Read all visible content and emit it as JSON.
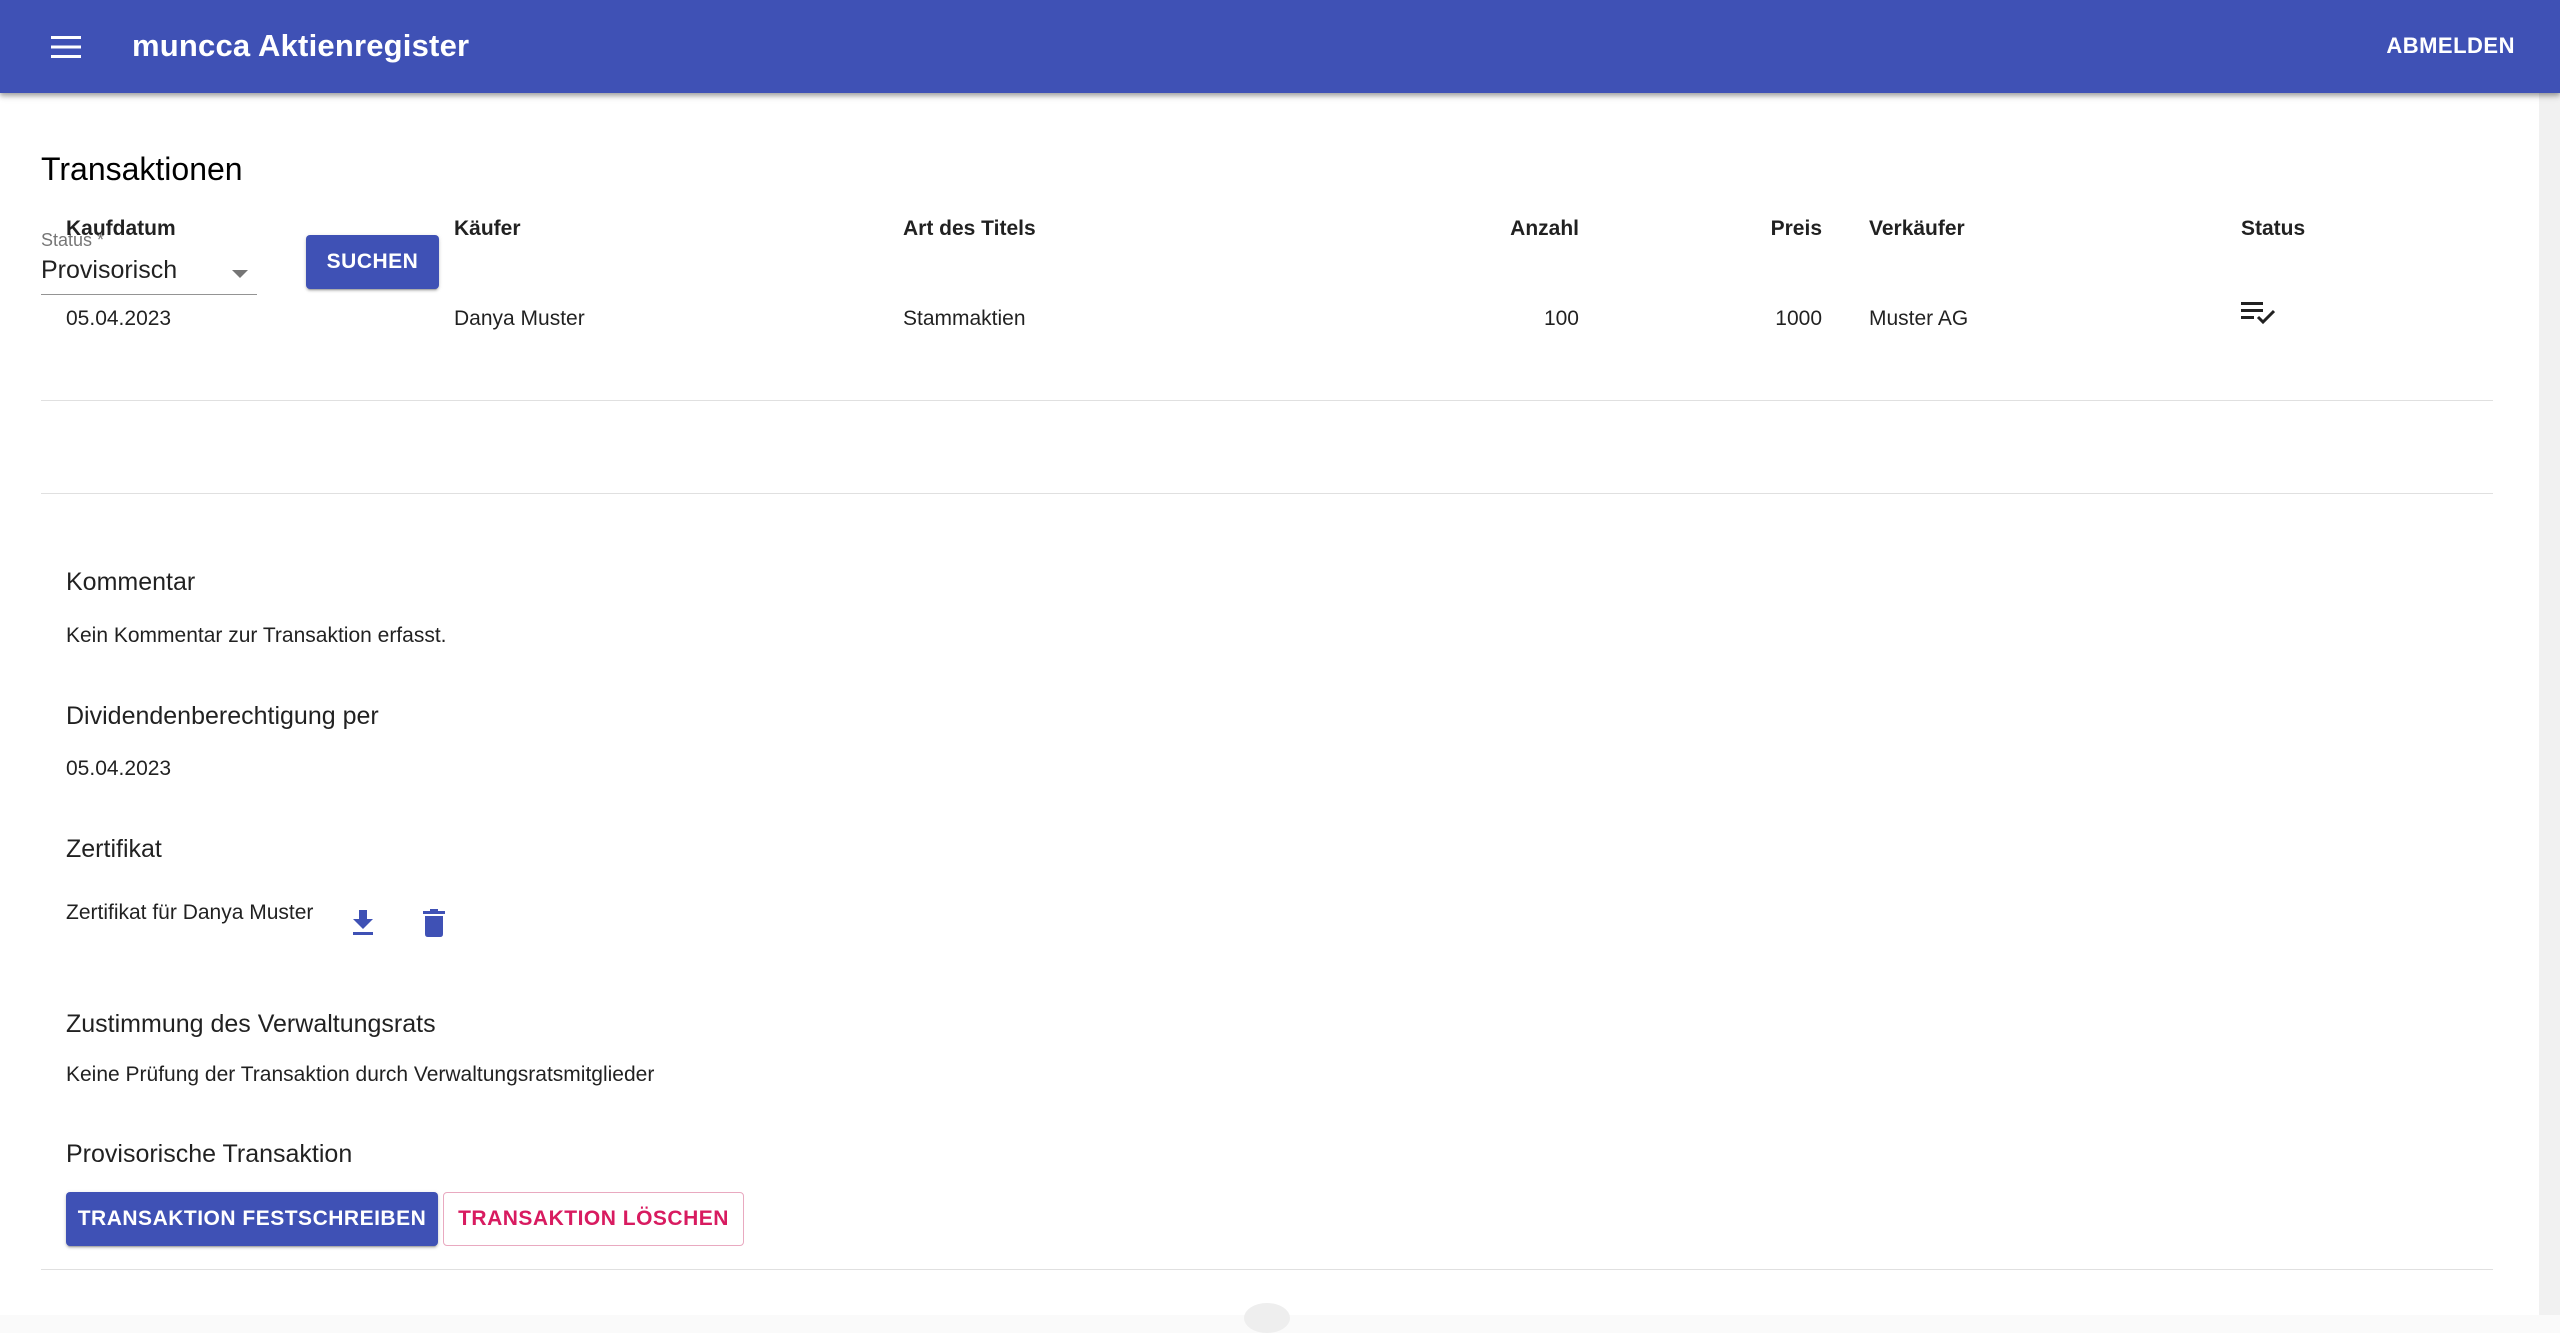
{
  "app": {
    "title": "muncca Aktienregister",
    "logout_label": "ABMELDEN",
    "brand_color": "#3f51b5",
    "menu_icon": "menu-icon"
  },
  "page": {
    "title": "Transaktionen"
  },
  "filter": {
    "status_label": "Status *",
    "status_value": "Provisorisch",
    "search_label": "SUCHEN"
  },
  "table": {
    "columns": [
      "Kaufdatum",
      "Käufer",
      "Art des Titels",
      "Anzahl",
      "Preis",
      "Verkäufer",
      "Status"
    ],
    "rows": [
      {
        "kaufdatum": "05.04.2023",
        "kaeufer": "Danya Muster",
        "art": "Stammaktien",
        "anzahl": "100",
        "preis": "1000",
        "verkaeufer": "Muster AG",
        "status_icon": "playlist-check-icon"
      }
    ]
  },
  "details": {
    "kommentar_head": "Kommentar",
    "kommentar_text": "Kein Kommentar zur Transaktion erfasst.",
    "dividende_head": "Dividendenberechtigung per",
    "dividende_text": "05.04.2023",
    "zertifikat_head": "Zertifikat",
    "zertifikat_text": "Zertifikat für Danya Muster",
    "zustimmung_head": "Zustimmung des Verwaltungsrats",
    "zustimmung_text": "Keine Prüfung der Transaktion durch Verwaltungsratsmitglieder",
    "provisorisch_head": "Provisorische Transaktion",
    "commit_label": "TRANSAKTION FESTSCHREIBEN",
    "delete_label": "TRANSAKTION LÖSCHEN",
    "delete_color": "#d81b60"
  }
}
